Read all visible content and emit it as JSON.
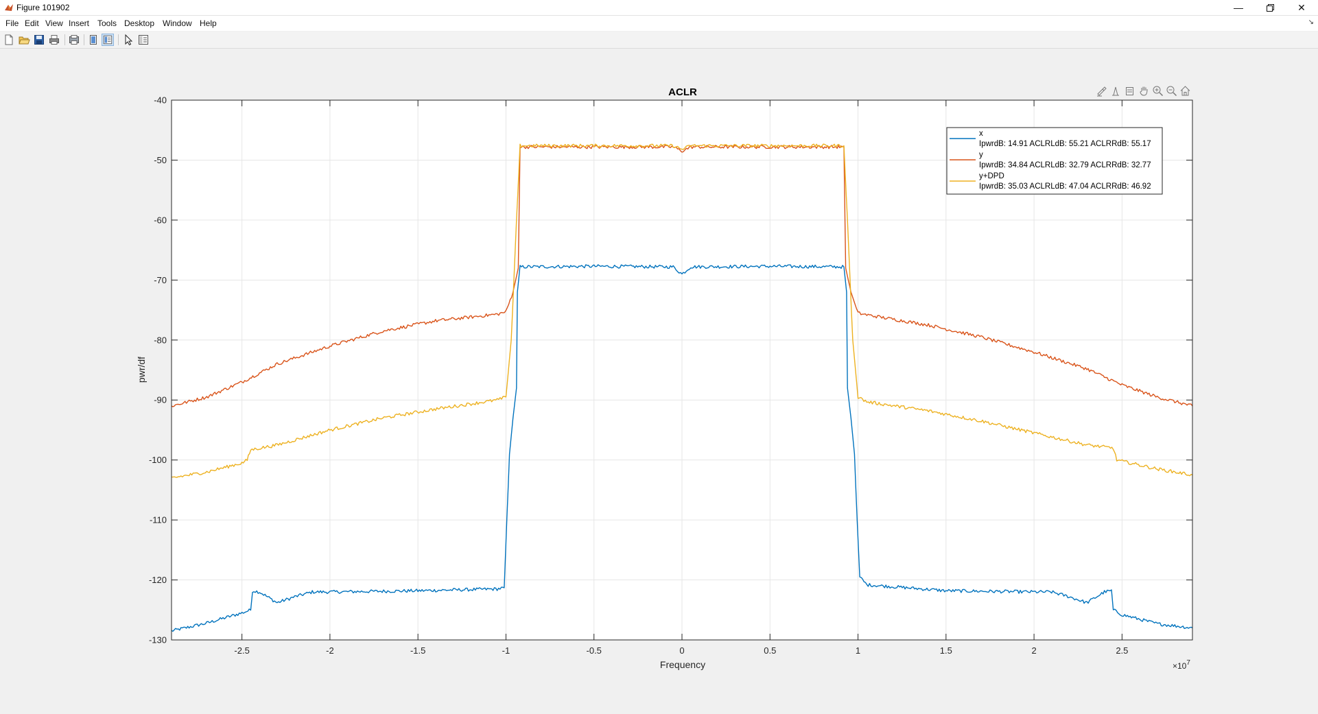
{
  "window": {
    "title": "Figure 101902"
  },
  "menu": {
    "items": [
      "File",
      "Edit",
      "View",
      "Insert",
      "Tools",
      "Desktop",
      "Window",
      "Help"
    ]
  },
  "toolbar": {
    "buttons": [
      "new-figure",
      "open-file",
      "save",
      "print",
      "print-preview",
      "hide-plot-tools",
      "show-plot-tools",
      "edit-plot",
      "insert-legend"
    ]
  },
  "axes_toolbar": {
    "buttons": [
      "brush",
      "data-cursor",
      "export",
      "pan",
      "zoom-in",
      "zoom-out",
      "home"
    ]
  },
  "chart_data": {
    "type": "line",
    "title": "ACLR",
    "xlabel": "Frequency",
    "ylabel": "pwr/df",
    "x_exponent_label": "×10",
    "x_exponent": "7",
    "xlim": [
      -29000000.0,
      29000000.0
    ],
    "ylim": [
      -130,
      -40
    ],
    "xticks": [
      -25000000.0,
      -20000000.0,
      -15000000.0,
      -10000000.0,
      -5000000.0,
      0,
      5000000.0,
      10000000.0,
      15000000.0,
      20000000.0,
      25000000.0
    ],
    "xtick_labels": [
      "-2.5",
      "-2",
      "-1.5",
      "-1",
      "-0.5",
      "0",
      "0.5",
      "1",
      "1.5",
      "2",
      "2.5"
    ],
    "yticks": [
      -130,
      -120,
      -110,
      -100,
      -90,
      -80,
      -70,
      -60,
      -50,
      -40
    ],
    "ytick_labels": [
      "-130",
      "-120",
      "-110",
      "-100",
      "-90",
      "-80",
      "-70",
      "-60",
      "-50",
      "-40"
    ],
    "grid": true,
    "legend_position": "top-right",
    "colors": {
      "x": "#0072bd",
      "y": "#d95319",
      "y+DPD": "#edb120"
    },
    "series": [
      {
        "name": "x",
        "legend_detail": "IpwrdB: 14.91 ACLRLdB: 55.21 ACLRRdB: 55.17",
        "color": "#0072bd",
        "points": [
          [
            -29000000.0,
            -128.5
          ],
          [
            -27000000.0,
            -127.2
          ],
          [
            -25000000.0,
            -125.5
          ],
          [
            -24500000.0,
            -125.0
          ],
          [
            -24400000.0,
            -121.8
          ],
          [
            -24000000.0,
            -122.0
          ],
          [
            -23000000.0,
            -123.8
          ],
          [
            -22000000.0,
            -122.8
          ],
          [
            -21000000.0,
            -122.0
          ],
          [
            -20000000.0,
            -122.0
          ],
          [
            -15000000.0,
            -121.8
          ],
          [
            -10500000.0,
            -121.5
          ],
          [
            -10100000.0,
            -121.3
          ],
          [
            -9950000.0,
            -110.0
          ],
          [
            -9800000.0,
            -99.0
          ],
          [
            -9600000.0,
            -93.0
          ],
          [
            -9400000.0,
            -88.0
          ],
          [
            -9350000.0,
            -72.0
          ],
          [
            -9200000.0,
            -67.8
          ],
          [
            -5000000.0,
            -67.7
          ],
          [
            -500000.0,
            -67.8
          ],
          [
            0,
            -69.0
          ],
          [
            500000.0,
            -67.8
          ],
          [
            5000000.0,
            -67.7
          ],
          [
            9200000.0,
            -67.8
          ],
          [
            9350000.0,
            -72.0
          ],
          [
            9400000.0,
            -88.0
          ],
          [
            9600000.0,
            -93.0
          ],
          [
            9800000.0,
            -99.0
          ],
          [
            9950000.0,
            -110.0
          ],
          [
            10100000.0,
            -119.5
          ],
          [
            10500000.0,
            -120.8
          ],
          [
            15000000.0,
            -121.8
          ],
          [
            20000000.0,
            -122.0
          ],
          [
            21000000.0,
            -122.0
          ],
          [
            22000000.0,
            -122.8
          ],
          [
            23000000.0,
            -123.8
          ],
          [
            24000000.0,
            -122.0
          ],
          [
            24400000.0,
            -121.8
          ],
          [
            24500000.0,
            -125.0
          ],
          [
            25000000.0,
            -125.8
          ],
          [
            27000000.0,
            -127.3
          ],
          [
            29000000.0,
            -128.0
          ]
        ]
      },
      {
        "name": "y",
        "legend_detail": "IpwrdB: 34.84 ACLRLdB: 32.79 ACLRRdB: 32.77",
        "color": "#d95319",
        "points": [
          [
            -29000000.0,
            -91.0
          ],
          [
            -27000000.0,
            -89.5
          ],
          [
            -25000000.0,
            -87.0
          ],
          [
            -23000000.0,
            -84.0
          ],
          [
            -20000000.0,
            -81.0
          ],
          [
            -17000000.0,
            -78.5
          ],
          [
            -14000000.0,
            -76.8
          ],
          [
            -10500000.0,
            -75.7
          ],
          [
            -10000000.0,
            -75.3
          ],
          [
            -9600000.0,
            -72.0
          ],
          [
            -9300000.0,
            -68.0
          ],
          [
            -9200000.0,
            -47.8
          ],
          [
            -5000000.0,
            -47.8
          ],
          [
            -500000.0,
            -47.8
          ],
          [
            0,
            -48.5
          ],
          [
            500000.0,
            -47.8
          ],
          [
            5000000.0,
            -47.8
          ],
          [
            9200000.0,
            -47.8
          ],
          [
            9300000.0,
            -68.0
          ],
          [
            9600000.0,
            -72.0
          ],
          [
            10000000.0,
            -75.5
          ],
          [
            10500000.0,
            -75.8
          ],
          [
            14000000.0,
            -77.5
          ],
          [
            17000000.0,
            -79.5
          ],
          [
            20000000.0,
            -82.0
          ],
          [
            23000000.0,
            -84.8
          ],
          [
            25000000.0,
            -87.5
          ],
          [
            27000000.0,
            -89.5
          ],
          [
            29000000.0,
            -91.0
          ]
        ]
      },
      {
        "name": "y+DPD",
        "legend_detail": "IpwrdB: 35.03 ACLRLdB: 47.04 ACLRRdB: 46.92",
        "color": "#edb120",
        "points": [
          [
            -29000000.0,
            -103.0
          ],
          [
            -27000000.0,
            -102.0
          ],
          [
            -25000000.0,
            -100.5
          ],
          [
            -24700000.0,
            -100.0
          ],
          [
            -24500000.0,
            -98.3
          ],
          [
            -23000000.0,
            -97.5
          ],
          [
            -20000000.0,
            -95.0
          ],
          [
            -17000000.0,
            -93.0
          ],
          [
            -14000000.0,
            -91.5
          ],
          [
            -10500000.0,
            -90.0
          ],
          [
            -10000000.0,
            -89.5
          ],
          [
            -9700000.0,
            -80.0
          ],
          [
            -9400000.0,
            -60.0
          ],
          [
            -9200000.0,
            -47.6
          ],
          [
            -5000000.0,
            -47.6
          ],
          [
            -500000.0,
            -47.6
          ],
          [
            0,
            -48.2
          ],
          [
            500000.0,
            -47.6
          ],
          [
            5000000.0,
            -47.6
          ],
          [
            9200000.0,
            -47.6
          ],
          [
            9400000.0,
            -60.0
          ],
          [
            9700000.0,
            -80.0
          ],
          [
            10000000.0,
            -89.5
          ],
          [
            10500000.0,
            -90.3
          ],
          [
            14000000.0,
            -91.8
          ],
          [
            17000000.0,
            -93.5
          ],
          [
            20000000.0,
            -95.5
          ],
          [
            23000000.0,
            -97.5
          ],
          [
            24500000.0,
            -98.0
          ],
          [
            24700000.0,
            -100.0
          ],
          [
            27000000.0,
            -101.5
          ],
          [
            29000000.0,
            -102.5
          ]
        ]
      }
    ]
  }
}
